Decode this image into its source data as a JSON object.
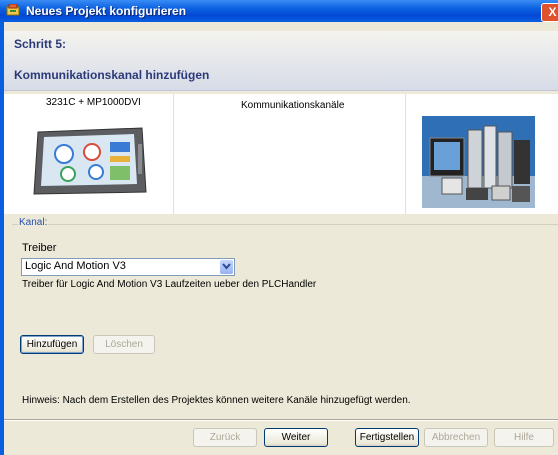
{
  "window": {
    "title": "Neues Projekt konfigurieren",
    "close_label": "X"
  },
  "header": {
    "step": "Schritt 5:",
    "title": "Kommunikationskanal hinzufügen"
  },
  "panels": {
    "device": "3231C + MP1000DVI",
    "channels": "Kommunikationskanäle"
  },
  "group": {
    "legend": "Kanal:",
    "driver_label": "Treiber",
    "driver_value": "Logic And Motion V3",
    "driver_description": "Treiber für Logic And Motion V3 Laufzeiten ueber den PLCHandler",
    "add_button": "Hinzufügen",
    "delete_button": "Löschen",
    "hint": "Hinweis: Nach dem Erstellen des Projektes können weitere Kanäle hinzugefügt werden."
  },
  "footer": {
    "back": "Zurück",
    "next": "Weiter",
    "finish": "Fertigstellen",
    "cancel": "Abbrechen",
    "help": "Hilfe"
  },
  "icons": {
    "app": "wizard-app-icon",
    "dropdown": "chevron-down-icon"
  },
  "colors": {
    "titlebar": "#0a5fe0",
    "header_text": "#2b3a7a",
    "legend_text": "#2a50b0"
  }
}
